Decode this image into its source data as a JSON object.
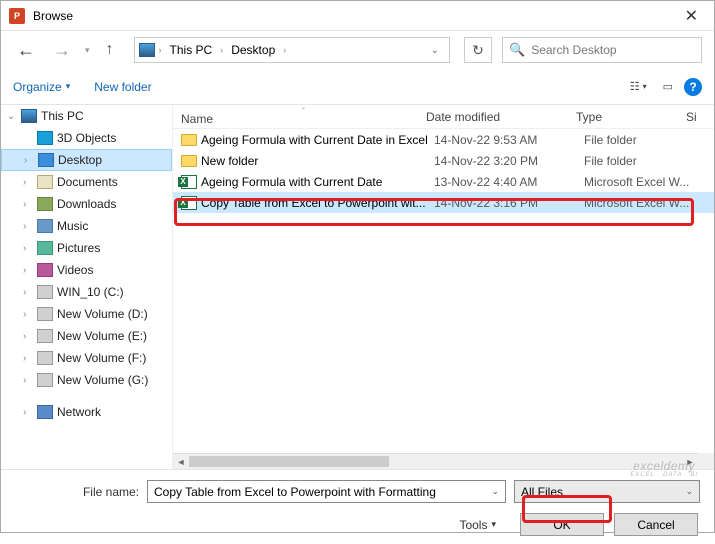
{
  "window": {
    "title": "Browse",
    "app_icon_label": "P"
  },
  "nav": {
    "breadcrumb": {
      "root": "This PC",
      "current": "Desktop"
    },
    "search_placeholder": "Search Desktop"
  },
  "toolbar": {
    "organize": "Organize",
    "newfolder": "New folder"
  },
  "sidebar": {
    "items": [
      {
        "label": "This PC",
        "chevron": "⌄",
        "icon": "pc"
      },
      {
        "label": "3D Objects",
        "chevron": "",
        "icon": "3d"
      },
      {
        "label": "Desktop",
        "chevron": "›",
        "icon": "desktop",
        "selected": true
      },
      {
        "label": "Documents",
        "chevron": "›",
        "icon": "docs"
      },
      {
        "label": "Downloads",
        "chevron": "›",
        "icon": "down"
      },
      {
        "label": "Music",
        "chevron": "›",
        "icon": "music"
      },
      {
        "label": "Pictures",
        "chevron": "›",
        "icon": "pics"
      },
      {
        "label": "Videos",
        "chevron": "›",
        "icon": "vids"
      },
      {
        "label": "WIN_10 (C:)",
        "chevron": "›",
        "icon": "drive"
      },
      {
        "label": "New Volume (D:)",
        "chevron": "›",
        "icon": "drive"
      },
      {
        "label": "New Volume (E:)",
        "chevron": "›",
        "icon": "drive"
      },
      {
        "label": "New Volume (F:)",
        "chevron": "›",
        "icon": "drive"
      },
      {
        "label": "New Volume (G:)",
        "chevron": "›",
        "icon": "drive"
      },
      {
        "label": "Network",
        "chevron": "›",
        "icon": "net",
        "top_gap": true
      }
    ]
  },
  "columns": {
    "name": "Name",
    "date": "Date modified",
    "type": "Type",
    "size": "Si"
  },
  "files": [
    {
      "name": "Ageing Formula with Current Date in Excel",
      "date": "14-Nov-22 9:53 AM",
      "type": "File folder",
      "icon": "folder"
    },
    {
      "name": "New folder",
      "date": "14-Nov-22 3:20 PM",
      "type": "File folder",
      "icon": "folder"
    },
    {
      "name": "Ageing Formula with Current Date",
      "date": "13-Nov-22 4:40 AM",
      "type": "Microsoft Excel W...",
      "icon": "excel"
    },
    {
      "name": "Copy Table from Excel to Powerpoint wit...",
      "date": "14-Nov-22 3:16 PM",
      "type": "Microsoft Excel W...",
      "icon": "excel",
      "selected": true
    }
  ],
  "footer": {
    "filename_label": "File name:",
    "filename_value": "Copy Table from Excel to Powerpoint with Formatting",
    "filter_value": "All Files",
    "tools": "Tools",
    "ok": "OK",
    "cancel": "Cancel"
  },
  "watermark": {
    "main": "exceldemy",
    "sub": "EXCEL · DATA · BI"
  }
}
